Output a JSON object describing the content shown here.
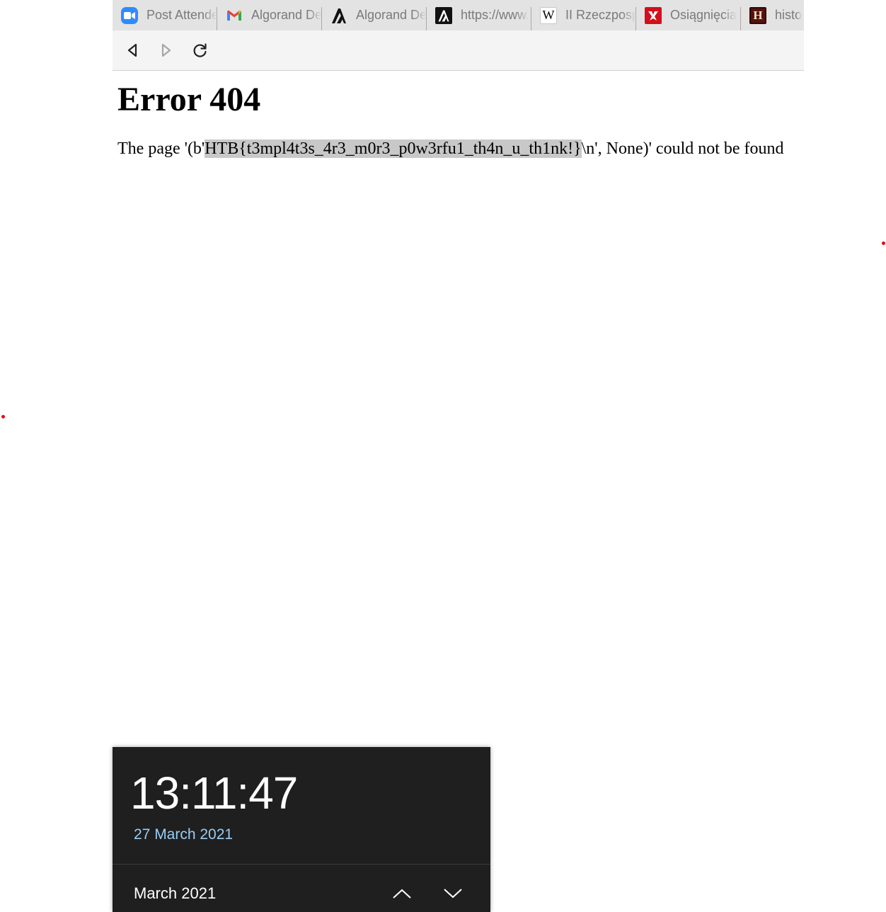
{
  "browser": {
    "tabs": [
      {
        "label": "Post Attendee",
        "icon": "zoom-icon"
      },
      {
        "label": "Algorand Dev",
        "icon": "gmail-icon"
      },
      {
        "label": "Algorand Dev",
        "icon": "algorand-icon"
      },
      {
        "label": "https://www.",
        "icon": "algorand-icon"
      },
      {
        "label": "II Rzeczpospolita",
        "icon": "wikipedia-icon"
      },
      {
        "label": "Osiągnięcia",
        "icon": "osiagniecia-icon"
      },
      {
        "label": "histo",
        "icon": "history-icon"
      }
    ],
    "wiki_glyph": "W",
    "hist_glyph": "H"
  },
  "page": {
    "heading": "Error 404",
    "message_prefix": "The page '(b'",
    "message_selected": "HTB{t3mpl4t3s_4r3_m0r3_p0w3rfu1_th4n_u_th1nk!}",
    "message_suffix": "\\n', None)' could not be found"
  },
  "clock": {
    "time": "13:11:47",
    "date": "27 March 2021",
    "month": "March 2021"
  },
  "colors": {
    "accent_date": "#99cdf4",
    "flyout_bg": "#1f1f1f",
    "selection": "#c8c8c8"
  }
}
